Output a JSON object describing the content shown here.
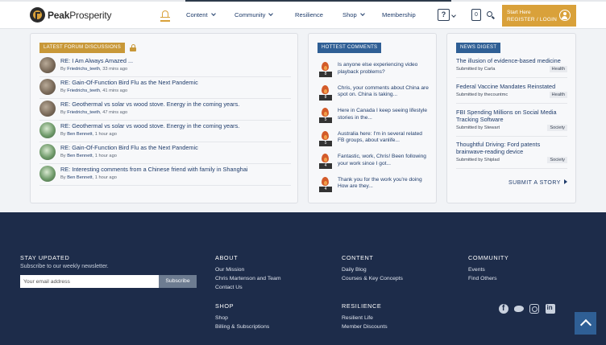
{
  "header": {
    "logo": {
      "bold": "Peak",
      "light": "Prosperity"
    },
    "nav": [
      {
        "label": "Content",
        "dropdown": true
      },
      {
        "label": "Community",
        "dropdown": true
      },
      {
        "label": "Resilience",
        "dropdown": false
      },
      {
        "label": "Shop",
        "dropdown": true
      },
      {
        "label": "Membership",
        "dropdown": false
      }
    ],
    "help_label": "?",
    "cart_count": "0",
    "login": {
      "line1": "Start Here",
      "line2": "REGISTER / LOGIN"
    },
    "accent": "#d9a13a"
  },
  "forum": {
    "tag": "LATEST FORUM DISCUSSIONS",
    "items": [
      {
        "title": "RE: I Am Always Amazed ...",
        "user": "Friedrichs_teeth",
        "time": "33 mins ago",
        "avatar": "a"
      },
      {
        "title": "RE: Gain-Of-Function Bird Flu as the Next Pandemic",
        "user": "Friedrichs_teeth",
        "time": "41 mins ago",
        "avatar": "a"
      },
      {
        "title": "RE: Geothermal vs solar vs wood stove. Energy in the coming years.",
        "user": "Friedrichs_teeth",
        "time": "47 mins ago",
        "avatar": "a"
      },
      {
        "title": "RE: Geothermal vs solar vs wood stove. Energy in the coming years.",
        "user": "Ben Bennett",
        "time": "1 hour ago",
        "avatar": "b"
      },
      {
        "title": "RE: Gain-Of-Function Bird Flu as the Next Pandemic",
        "user": "Ben Bennett",
        "time": "1 hour ago",
        "avatar": "b"
      },
      {
        "title": "RE: Interesting comments from a Chinese friend with family in Shanghai",
        "user": "Ben Bennett",
        "time": "1 hour ago",
        "avatar": "b"
      }
    ],
    "by_label": "By",
    "sep": ", "
  },
  "hottest": {
    "tag": "HOTTEST COMMENTS",
    "items": [
      {
        "count": "8",
        "text": "Is anyone else experiencing video playback problems?"
      },
      {
        "count": "8",
        "text": "Chris, your comments about China are spot on. China is taking..."
      },
      {
        "count": "5",
        "text": "Here in Canada I keep seeing lifestyle stories in the..."
      },
      {
        "count": "5",
        "text": "Australia here: I'm in several related FB groups, about vanlife..."
      },
      {
        "count": "4",
        "text": "Fantastic, work, Chris! Been following your work since I got..."
      },
      {
        "count": "4",
        "text": "Thank you for the work you're doing How are they..."
      }
    ]
  },
  "news": {
    "tag": "NEWS DIGEST",
    "items": [
      {
        "title": "The illusion of evidence-based medicine",
        "by": "Submitted by Carla",
        "category": "Health"
      },
      {
        "title": "Federal Vaccine Mandates Reinstated",
        "by": "Submitted by thecountmc",
        "category": "Health"
      },
      {
        "title": "FBI Spending Millions on Social Media Tracking Software",
        "by": "Submitted by Stewart",
        "category": "Society"
      },
      {
        "title": "Thoughtful Driving: Ford patents brainwave-reading device",
        "by": "Submitted by Shiplad",
        "category": "Society"
      }
    ],
    "submit_label": "SUBMIT A STORY"
  },
  "footer": {
    "stay_updated": "STAY UPDATED",
    "subscribe_text": "Subscribe to our weekly newsletter.",
    "email_placeholder": "Your email address",
    "subscribe_button": "Subscribe",
    "about": {
      "heading": "ABOUT",
      "links": [
        "Our Mission",
        "Chris Martenson and Team",
        "Contact Us"
      ]
    },
    "content": {
      "heading": "CONTENT",
      "links": [
        "Daily Blog",
        "Courses & Key Concepts"
      ]
    },
    "community": {
      "heading": "COMMUNITY",
      "links": [
        "Events",
        "Find Others"
      ]
    },
    "shop": {
      "heading": "SHOP",
      "links": [
        "Shop",
        "Billing & Subscriptions"
      ]
    },
    "resilience": {
      "heading": "RESILIENCE",
      "links": [
        "Resilient Life",
        "Member Discounts"
      ]
    },
    "social_icons": [
      "facebook-icon",
      "twitter-icon",
      "instagram-icon",
      "linkedin-icon"
    ],
    "background": "#1d2c4a"
  }
}
